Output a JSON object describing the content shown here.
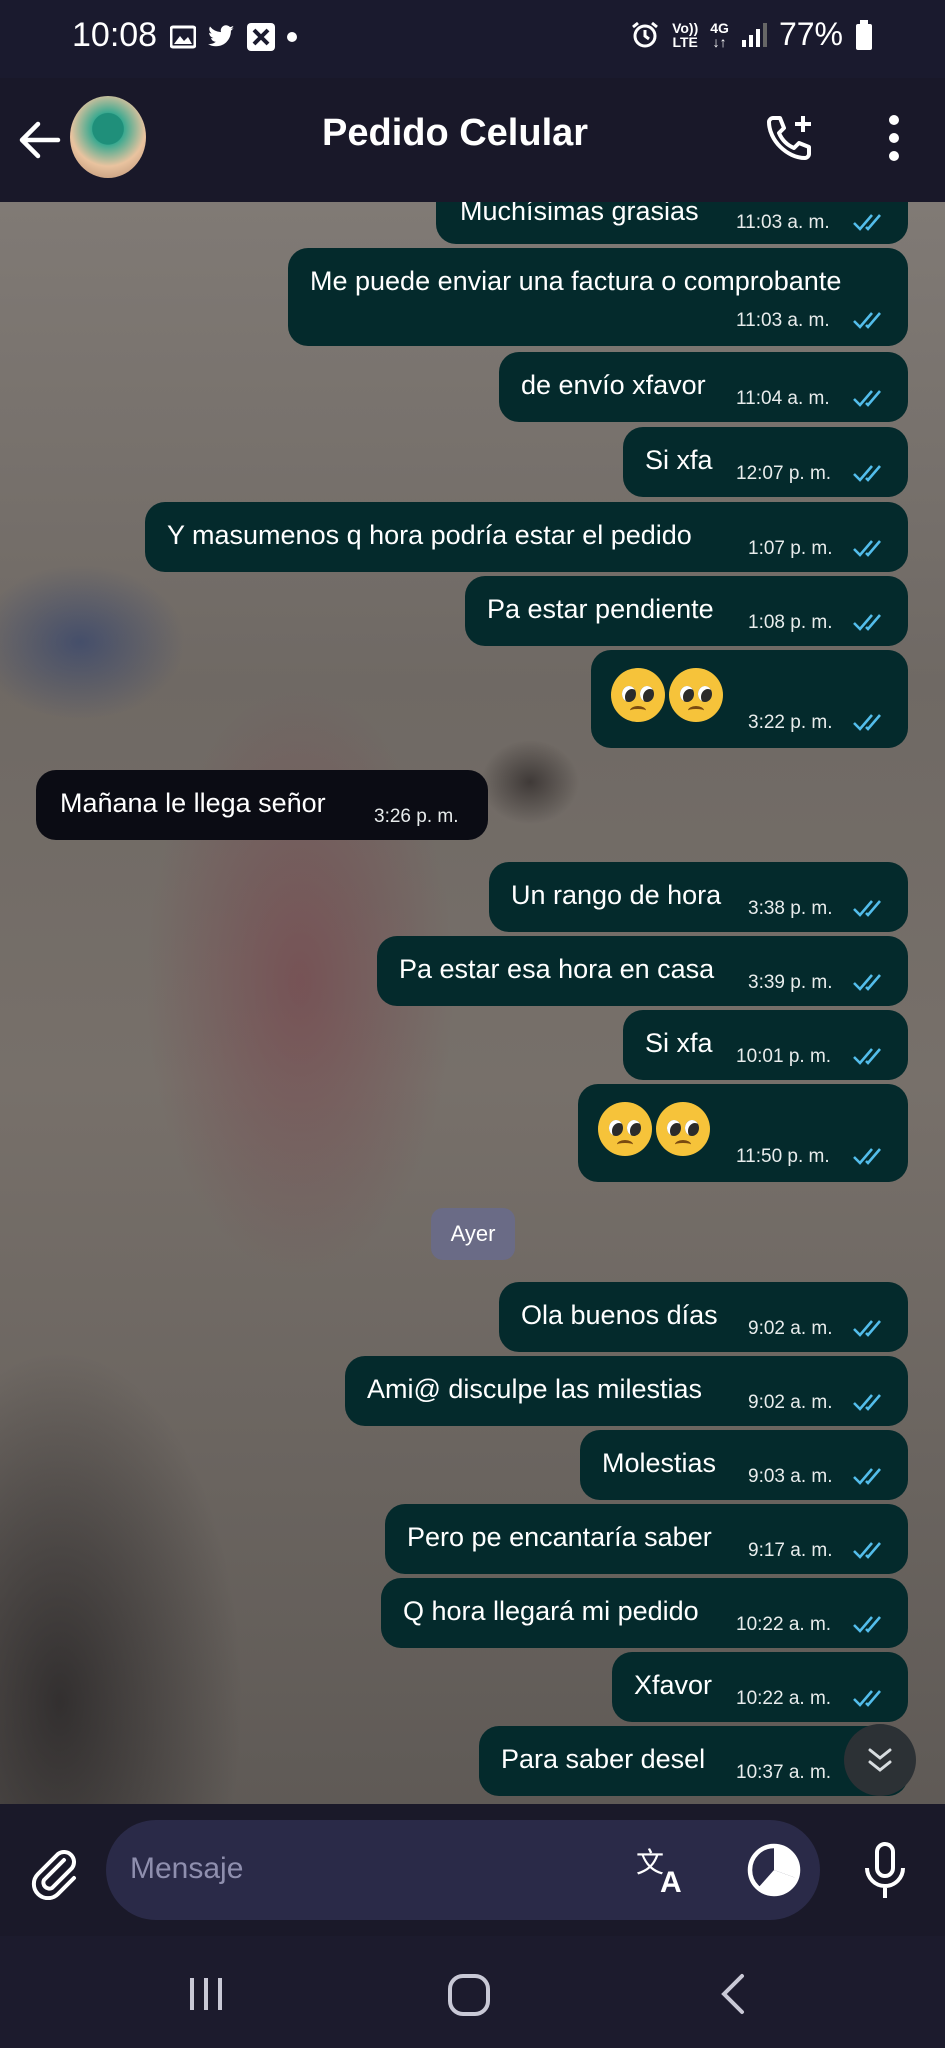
{
  "status_bar": {
    "time": "10:08",
    "battery": "77%",
    "net_top": "Vo))",
    "net_bottom": "LTE",
    "gen": "4G"
  },
  "app_bar": {
    "title": "Pedido Celular"
  },
  "messages": [
    {
      "text": "Muchísimas grasias",
      "time": "11:03 a. m."
    },
    {
      "text": "Me puede enviar una factura o comprobante",
      "time": "11:03 a. m."
    },
    {
      "text": "de envío xfavor",
      "time": "11:04 a. m."
    },
    {
      "text": "Si xfa",
      "time": "12:07 p. m."
    },
    {
      "text": "Y masumenos q hora podría estar el pedido",
      "time": "1:07 p. m."
    },
    {
      "text": "Pa estar pendiente",
      "time": "1:08 p. m."
    },
    {
      "text": "🥺🥺",
      "time": "3:22 p. m."
    },
    {
      "text": "Mañana le llega señor",
      "time": "3:26 p. m."
    },
    {
      "text": "Un rango de hora",
      "time": "3:38 p. m."
    },
    {
      "text": "Pa estar esa hora en casa",
      "time": "3:39 p. m."
    },
    {
      "text": "Si xfa",
      "time": "10:01 p. m."
    },
    {
      "text": "🥺🥺",
      "time": "11:50 p. m."
    },
    {
      "text": "Ola buenos días",
      "time": "9:02 a. m."
    },
    {
      "text": "Ami@ disculpe las milestias",
      "time": "9:02 a. m."
    },
    {
      "text": "Molestias",
      "time": "9:03 a. m."
    },
    {
      "text": "Pero pe encantaría saber",
      "time": "9:17 a. m."
    },
    {
      "text": "Q hora llegará mi pedido",
      "time": "10:22 a. m."
    },
    {
      "text": "Xfavor",
      "time": "10:22 a. m."
    },
    {
      "text": "Para saber desel",
      "time": "10:37 a. m."
    }
  ],
  "date_separator": "Ayer",
  "input": {
    "placeholder": "Mensaje"
  },
  "colors": {
    "outgoing_bubble": "#042a2c",
    "incoming_bubble": "#0b0c14",
    "read_ticks": "#53bdeb"
  }
}
